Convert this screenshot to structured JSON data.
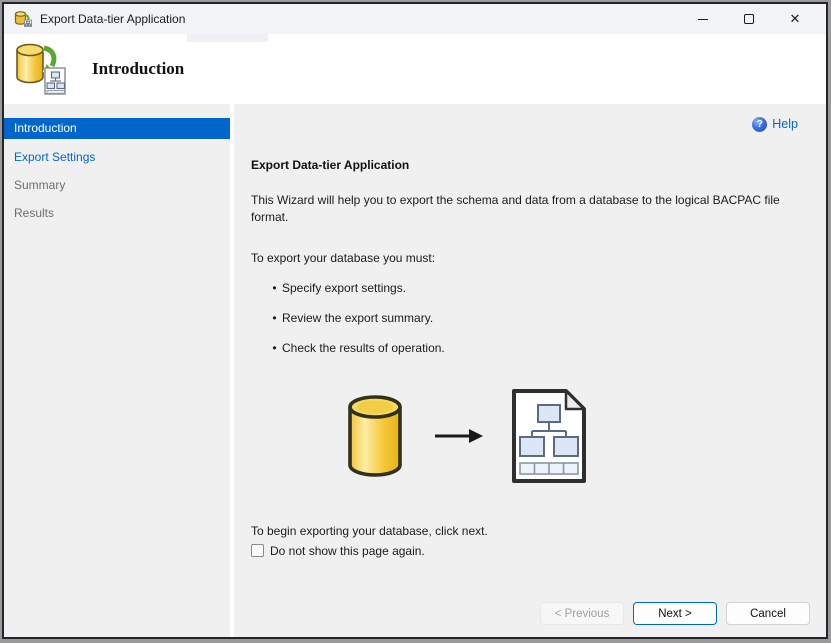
{
  "window": {
    "title": "Export Data-tier Application"
  },
  "icons": {
    "minimize": "–",
    "close": "✕",
    "help": "?",
    "bullet": "•"
  },
  "header": {
    "title": "Introduction"
  },
  "sidebar": {
    "items": [
      {
        "label": "Introduction",
        "state": "active"
      },
      {
        "label": "Export Settings",
        "state": "link"
      },
      {
        "label": "Summary",
        "state": "muted"
      },
      {
        "label": "Results",
        "state": "muted"
      }
    ]
  },
  "content": {
    "help_label": "Help",
    "heading": "Export Data-tier Application",
    "intro": "This Wizard will help you to export the schema and data from a database to the logical BACPAC file format.",
    "requirements_label": "To export your database you must:",
    "bullets": [
      "Specify export settings.",
      "Review the export summary.",
      "Check the results of operation."
    ],
    "footer_note": "To begin exporting your database, click next.",
    "checkbox_label": "Do not show this page again.",
    "checkbox_checked": false
  },
  "buttons": {
    "previous": "< Previous",
    "next": "Next >",
    "cancel": "Cancel"
  },
  "colors": {
    "accent": "#0066cc",
    "panel": "#f0f0f0",
    "titlebar": "#f2f3f7",
    "link": "#0066cc",
    "muted_text": "#6e6e6e",
    "next_border": "#0067c0"
  }
}
